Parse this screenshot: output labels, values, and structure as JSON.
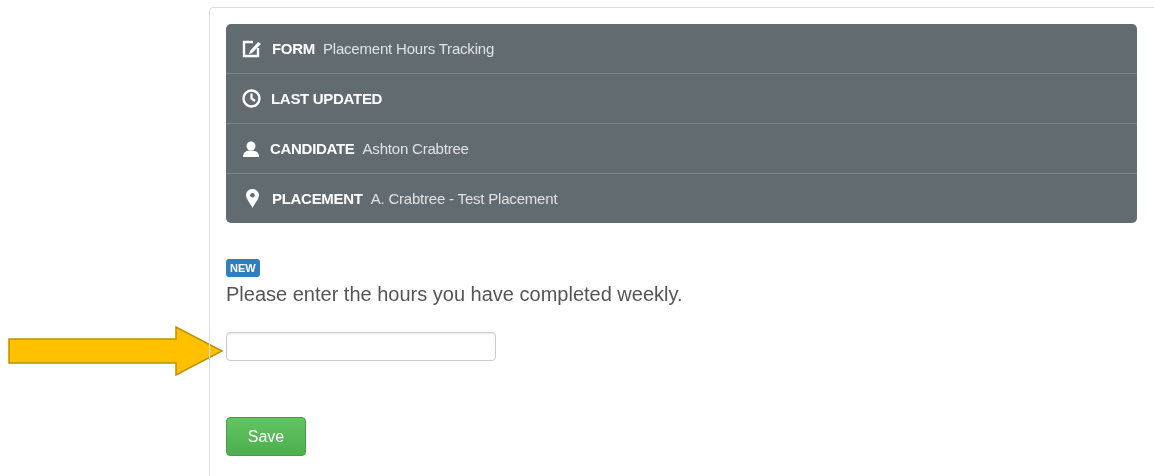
{
  "info_rows": [
    {
      "kind": "form",
      "label": "FORM",
      "value": "Placement Hours Tracking"
    },
    {
      "kind": "updated",
      "label": "LAST UPDATED"
    },
    {
      "kind": "candidate",
      "label": "CANDIDATE",
      "value": "Ashton Crabtree"
    },
    {
      "kind": "placement",
      "label": "PLACEMENT",
      "value": "A. Crabtree - Test Placement"
    }
  ],
  "question": {
    "badge": "NEW",
    "text": "Please enter the hours you have completed weekly."
  },
  "buttons": [
    "Save"
  ]
}
